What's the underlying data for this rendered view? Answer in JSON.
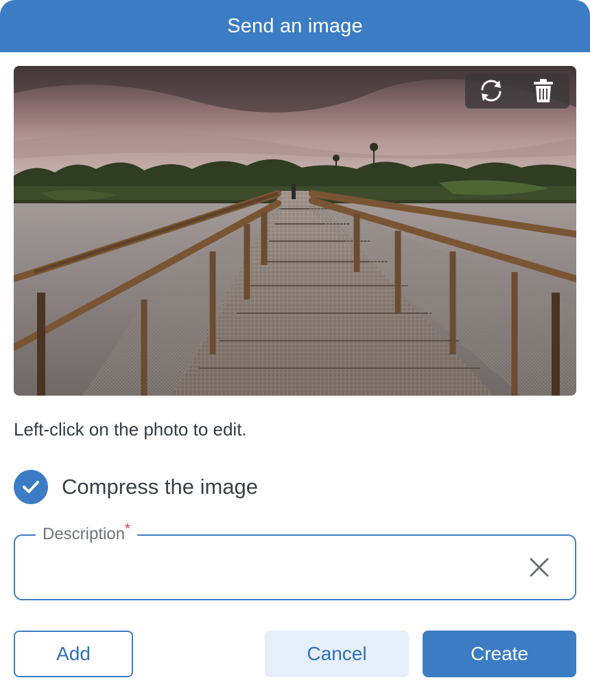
{
  "dialog": {
    "title": "Send an image",
    "accent_color": "#3b7cc4"
  },
  "photo": {
    "toolbar": {
      "replace_icon": "refresh-icon",
      "delete_icon": "trash-icon"
    }
  },
  "hint": "Left-click on the photo to edit.",
  "compress": {
    "label": "Compress the image",
    "checked": true
  },
  "description": {
    "label": "Description",
    "required_mark": "*",
    "value": "",
    "clear_icon": "close-icon"
  },
  "buttons": {
    "add": "Add",
    "cancel": "Cancel",
    "create": "Create"
  }
}
